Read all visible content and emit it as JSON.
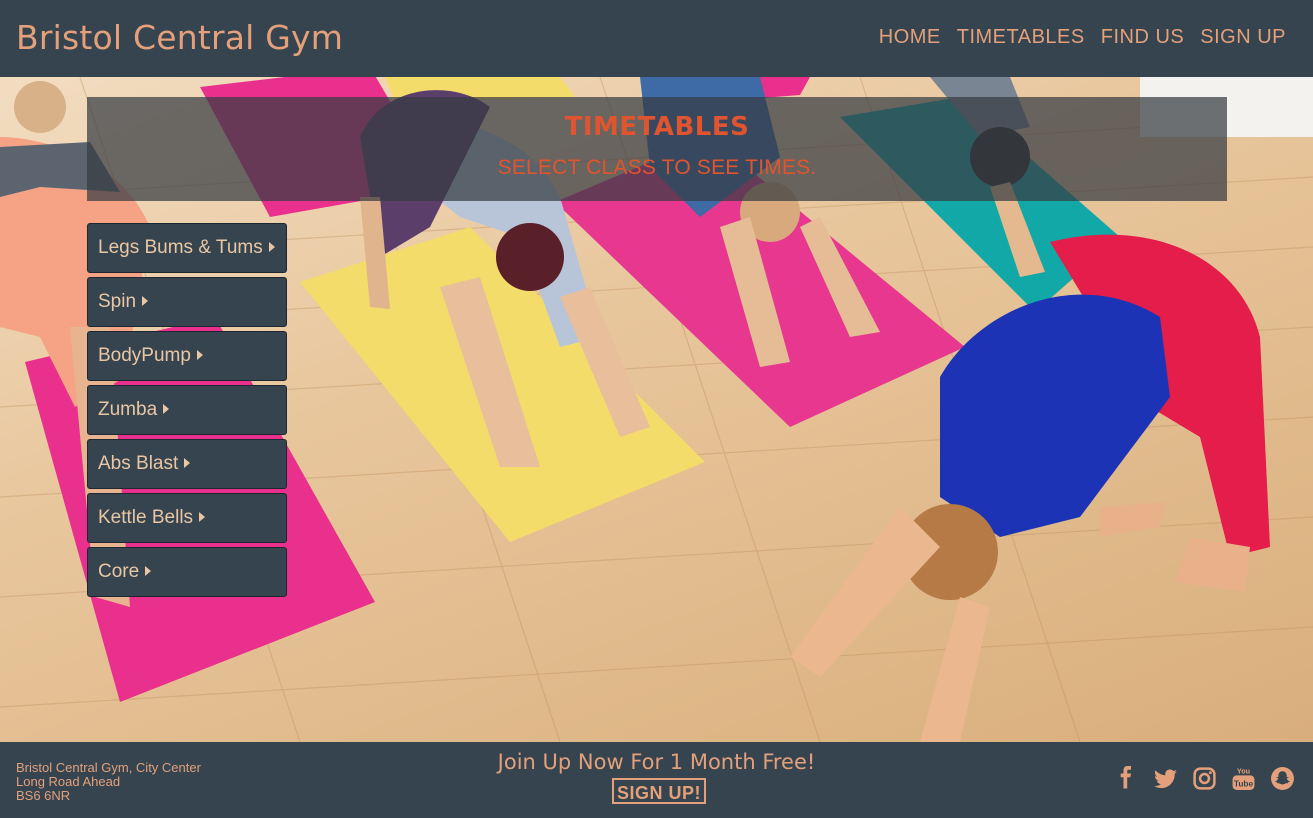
{
  "header": {
    "brand": "Bristol Central Gym",
    "nav": [
      "HOME",
      "TIMETABLES",
      "FIND US",
      "SIGN UP"
    ]
  },
  "banner": {
    "title": "TIMETABLES",
    "subtitle": "SELECT CLASS TO SEE TIMES."
  },
  "classes": [
    "Legs Bums & Tums",
    "Spin",
    "BodyPump",
    "Zumba",
    "Abs Blast",
    "Kettle Bells",
    "Core"
  ],
  "footer": {
    "address": [
      "Bristol Central Gym, City Center",
      "Long Road Ahead",
      "BS6 6NR"
    ],
    "promo": "Join Up Now For 1 Month Free!",
    "signup_button": "SIGN UP!",
    "socials": [
      "facebook-icon",
      "twitter-icon",
      "instagram-icon",
      "youtube-icon",
      "snapchat-icon"
    ]
  },
  "colors": {
    "bar": "#36444f",
    "accent_text": "#e3a07a",
    "banner_text": "#e0552f"
  }
}
